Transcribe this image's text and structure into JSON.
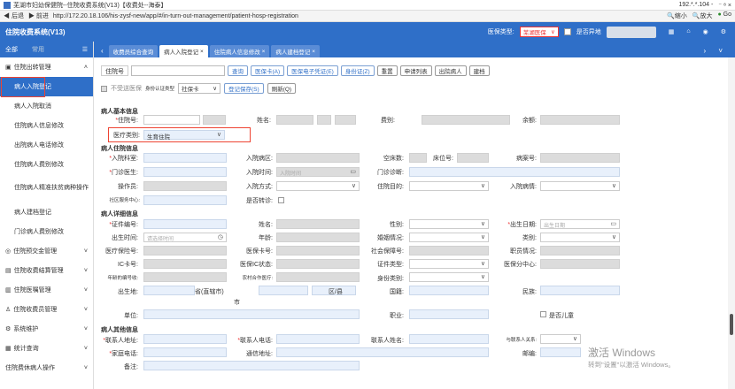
{
  "window": {
    "title": "芜湖市妇幼保健院--住院收费系统(V13)【收费处--海泰】",
    "right_text": "192.*.*.104 -",
    "controls": "⁻ ⁸ ×"
  },
  "address": {
    "back": "后退",
    "forward": "前进",
    "url": "http://172.20.18.106/his-zysf-new/app/#/in-turn-out-management/patient-hosp-registration",
    "zoom_out": "缩小",
    "zoom_in": "放大",
    "go": "Go"
  },
  "app": {
    "title": "住院收费系统(V13)",
    "insurance_type_label": "医保类型:",
    "insurance_type_value": "芜湖医保",
    "remote_label": "是否异地"
  },
  "sidebar": {
    "tab_all": "全部",
    "tab_common": "常用",
    "group_inout": "住院出转管理",
    "items": [
      "病人入院登记",
      "病人入院取消",
      "住院病人信息修改",
      "出院病人电话修改",
      "住院病人费别修改",
      "住院病人精准扶贫病种操作",
      "病人建档登记",
      "门诊病人费别修改"
    ],
    "groups": [
      "住院预交金管理",
      "住院收费结算管理",
      "住院医嘱管理",
      "住院收费员管理",
      "系统维护",
      "统计查询",
      "住院费休病人操作"
    ]
  },
  "tabs": [
    "收费员综合查询",
    "病人入院登记",
    "住院病人信息修改",
    "病人建档登记"
  ],
  "toolbar": {
    "hosp_no_label": "住院号",
    "buttons": [
      "查询",
      "医保卡(A)",
      "医保电子凭证(E)",
      "身份证(Z)",
      "重置",
      "申请列表",
      "出院病人",
      "建档"
    ],
    "no_insurance_label": "不受送医保",
    "id_type_label": "身份认证类型",
    "id_type_value": "社保卡",
    "save_button": "登记保存(S)",
    "refresh_button": "刷新(Q)"
  },
  "sections": {
    "basic": "病人基本信息",
    "hosp": "病人住院信息",
    "detail": "病人详细信息",
    "other": "病人其他信息"
  },
  "basic": {
    "hosp_no": "住院号:",
    "name": "姓名:",
    "fee_type": "费别:",
    "balance": "余额:",
    "med_category": "医疗类别:",
    "med_category_value": "生育住院"
  },
  "hosp": {
    "dept": "入院科室:",
    "ward": "入院病区:",
    "bed_empty": "空床数:",
    "bed_no": "床位号:",
    "case_no": "病案号:",
    "outpatient_doctor": "门诊医生:",
    "admit_time": "入院时间:",
    "admit_time_ph": "入院时间",
    "outpatient_diag": "门诊诊断:",
    "operator": "操作员:",
    "admit_way": "入院方式:",
    "hosp_purpose": "住院目的:",
    "admit_condition": "入院病情:",
    "community_center": "社区服务中心:",
    "transferred": "是否转诊:"
  },
  "detail": {
    "id_no": "证件编号:",
    "name": "姓名:",
    "gender": "性别:",
    "birth_date": "出生日期:",
    "birth_date_ph": "出生日期",
    "birth_time": "出生时间:",
    "birth_time_ph": "请选择时间",
    "age": "年龄:",
    "marriage": "婚姻情况:",
    "category": "类别:",
    "med_insurance_no": "医疗保险号:",
    "insurance_card": "医保卡号:",
    "social_card": "社会保障号:",
    "occupation_status": "职员情况:",
    "ic_card": "IC卡号:",
    "ic_status": "医保IC状态:",
    "id_type": "证件类型:",
    "insurance_center": "医保分中心:",
    "unit_code": "年龄的编号收:",
    "rural_coop": "农村合作医疗:",
    "identity": "身份类别:",
    "birthplace": "出生地:",
    "province": "省(直辖市)",
    "city": "市",
    "district": "区/县",
    "nationality": "国籍:",
    "ethnicity": "民族:",
    "unit": "单位:",
    "job": "职业:",
    "child": "是否儿童"
  },
  "other": {
    "contact_address": "联系人地址:",
    "contact_phone": "联系人电话:",
    "contact_name": "联系人姓名:",
    "relation": "与联系人关系:",
    "home_phone": "家庭电话:",
    "mail_address": "通信地址:",
    "postcode": "邮编:",
    "remark": "备注:"
  },
  "watermark": {
    "line1": "激活 Windows",
    "line2": "转到\"设置\"以激活 Windows。"
  }
}
